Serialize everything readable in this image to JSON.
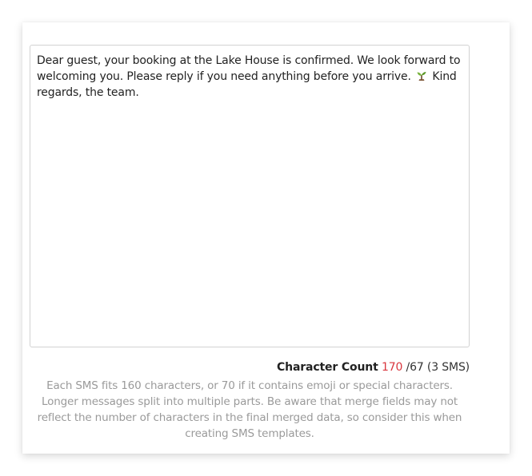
{
  "message": {
    "text_before": "Dear guest, your booking at the Lake House is confirmed. We look forward to welcoming you. Please reply if you need anything before you arrive. ",
    "emoji": "sprout-icon",
    "text_after": " Kind regards, the team."
  },
  "counter": {
    "label": "Character Count",
    "count": "170",
    "limit": "/67 (3 SMS)",
    "count_color": "#d9363e"
  },
  "help_text": "Each SMS fits 160 characters, or 70 if it contains emoji or special characters. Longer messages split into multiple parts. Be aware that merge fields may not reflect the number of characters in the final merged data, so consider this when creating SMS templates."
}
